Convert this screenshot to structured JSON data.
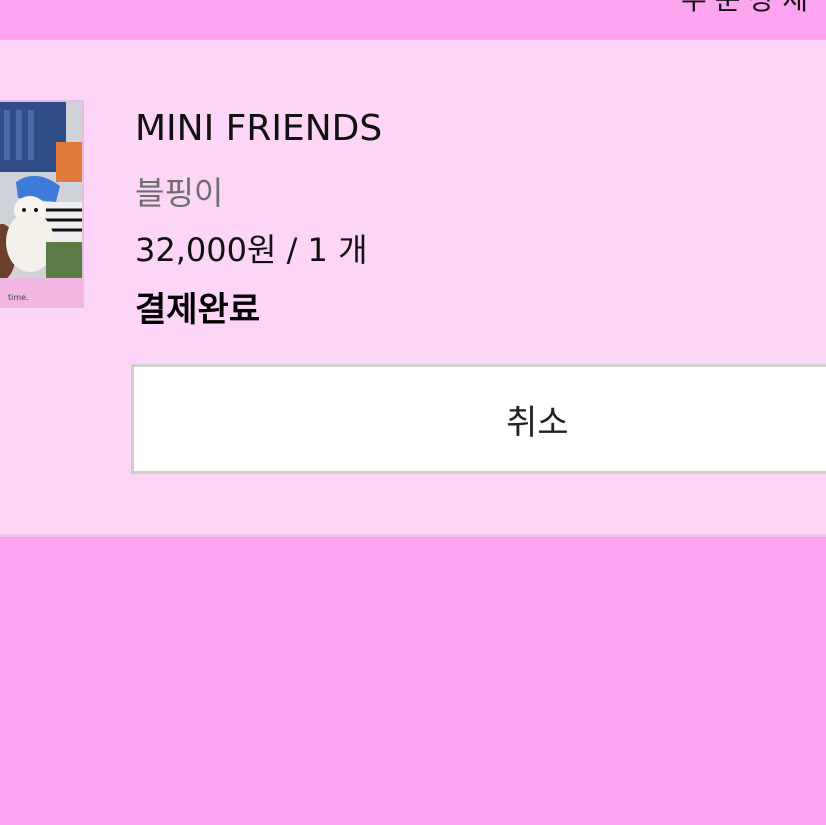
{
  "header": {
    "status_text": "주문상세"
  },
  "order": {
    "product_name": "MINI FRIENDS",
    "option_name": "블핑이",
    "price_qty": "32,000원 / 1 개",
    "status": "결제완료",
    "cancel_label": "취소",
    "thumbnail_caption": "time."
  },
  "colors": {
    "background": "#fda4f0",
    "card_background": "#fdd6f7",
    "button_background": "#ffffff",
    "button_border": "#cfcfcf"
  }
}
